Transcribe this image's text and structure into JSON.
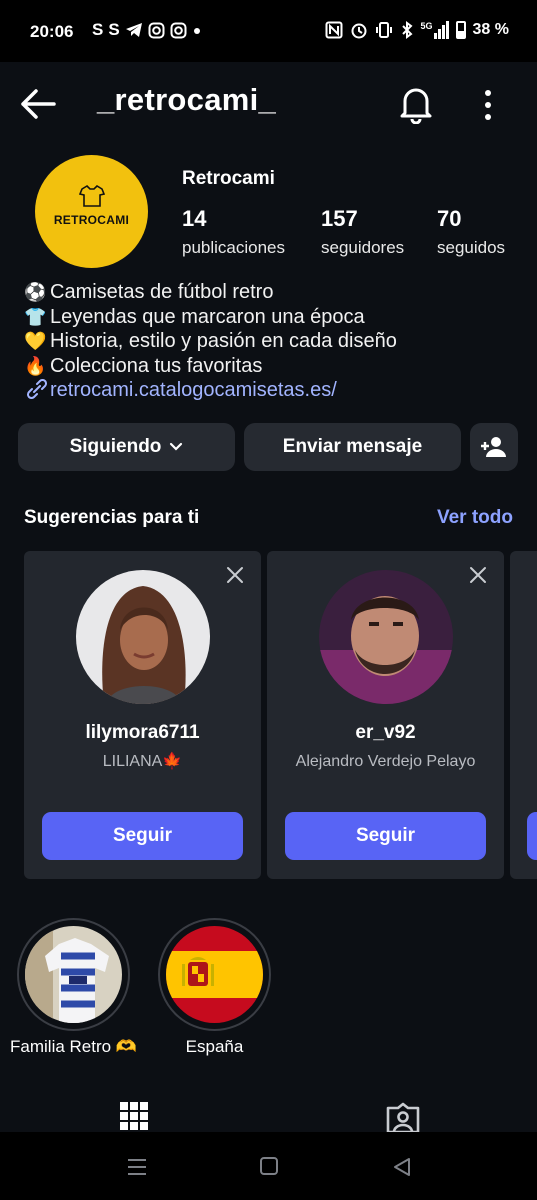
{
  "status_bar": {
    "time": "20:06",
    "left_icons": [
      "S",
      "S"
    ],
    "left_icon_names": [
      "s-app-icon",
      "s-app-icon",
      "telegram-icon",
      "instagram-icon",
      "instagram-icon",
      "dot-icon"
    ],
    "network": "5G",
    "battery": "38 %"
  },
  "header": {
    "username": "_retrocami_"
  },
  "profile": {
    "avatar_text": "RETROCAMI",
    "display_name": "Retrocami",
    "stats": [
      {
        "value": "14",
        "label": "publicaciones"
      },
      {
        "value": "157",
        "label": "seguidores"
      },
      {
        "value": "70",
        "label": "seguidos"
      }
    ],
    "bio": [
      {
        "emoji": "⚽",
        "text": "Camisetas de fútbol retro"
      },
      {
        "emoji": "👕",
        "text": "Leyendas que marcaron una época"
      },
      {
        "emoji": "💛",
        "text": "Historia, estilo y pasión en cada diseño"
      },
      {
        "emoji": "🔥",
        "text": "Colecciona tus favoritas"
      }
    ],
    "link": "retrocami.catalogocamisetas.es/"
  },
  "actions": {
    "following_label": "Siguiendo",
    "message_label": "Enviar mensaje"
  },
  "suggestions": {
    "title": "Sugerencias para ti",
    "see_all": "Ver todo",
    "cards": [
      {
        "username": "lilymora6711",
        "name": "LILIANA🍁",
        "button": "Seguir"
      },
      {
        "username": "er_v92",
        "name": "Alejandro Verdejo Pelayo",
        "button": "Seguir"
      }
    ]
  },
  "highlights": [
    {
      "label": "Familia Retro 🫶"
    },
    {
      "label": "España"
    }
  ],
  "colors": {
    "background": "#0c0f14",
    "accent_button": "#5864f5",
    "link": "#a2b4ff",
    "avatar_bg": "#f2c10e"
  }
}
